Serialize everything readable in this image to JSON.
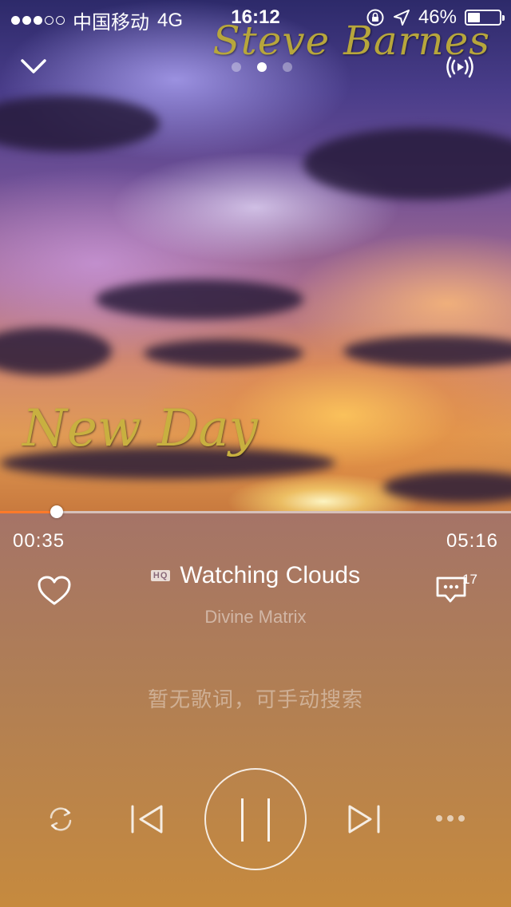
{
  "status_bar": {
    "carrier": "中国移动",
    "network": "4G",
    "time": "16:12",
    "battery_percent": "46%",
    "battery_level": 0.46,
    "signal_bars": 3,
    "signal_total": 5
  },
  "album_art": {
    "artist_text": "Steve Barnes",
    "title_text": "New Day"
  },
  "top_bar": {
    "collapse_icon": "chevron-down-icon",
    "cast_icon": "broadcast-icon",
    "page_count": 3,
    "active_page": 2
  },
  "playback": {
    "current_time": "00:35",
    "total_time": "05:16",
    "progress": 0.111,
    "progress_color": "#ff7a2a"
  },
  "track": {
    "quality_badge": "HQ",
    "title": "Watching Clouds",
    "artist": "Divine Matrix",
    "comment_count": "17"
  },
  "lyrics": {
    "empty_message": "暂无歌词，可手动搜索"
  },
  "controls": {
    "repeat_icon": "repeat-icon",
    "prev_icon": "previous-track-icon",
    "play_state": "playing",
    "pause_icon": "pause-icon",
    "next_icon": "next-track-icon",
    "more_icon": "more-dots-icon"
  }
}
